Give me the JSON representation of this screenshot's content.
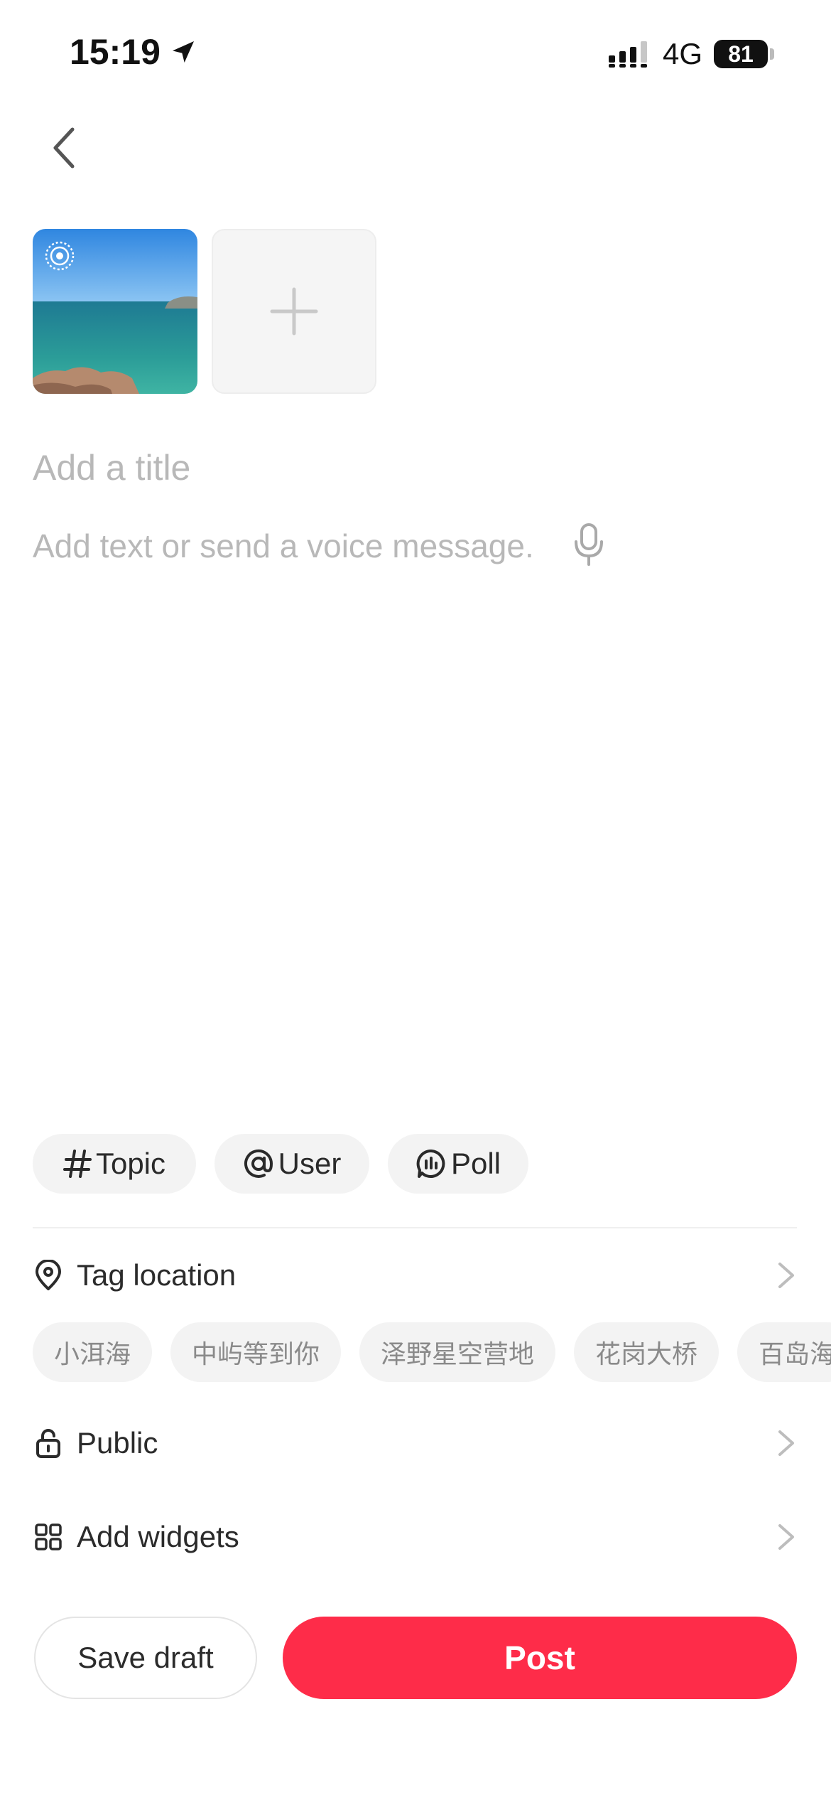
{
  "status_bar": {
    "time": "15:19",
    "network": "4G",
    "battery": "81",
    "icons": [
      "location-arrow-icon",
      "signal-icon",
      "battery-icon"
    ]
  },
  "nav": {
    "back_icon": "chevron-left-icon"
  },
  "media": {
    "live_icon": "live-photo-icon",
    "add_icon": "plus-icon"
  },
  "editor": {
    "title_placeholder": "Add a title",
    "body_placeholder": "Add text or send a voice message.",
    "mic_icon": "microphone-icon"
  },
  "chips": [
    {
      "label": "Topic",
      "icon": "hashtag-icon"
    },
    {
      "label": "User",
      "icon": "at-icon"
    },
    {
      "label": "Poll",
      "icon": "poll-icon"
    }
  ],
  "location": {
    "label": "Tag location",
    "icon": "location-pin-icon",
    "suggestions": [
      "小洱海",
      "中屿等到你",
      "泽野星空营地",
      "花岗大桥",
      "百岛海"
    ]
  },
  "visibility": {
    "label": "Public",
    "icon": "lock-open-icon"
  },
  "widgets": {
    "label": "Add widgets",
    "icon": "grid-icon"
  },
  "actions": {
    "save_draft": "Save draft",
    "post": "Post"
  },
  "colors": {
    "accent": "#fe2c49",
    "placeholder": "#b8b8b8",
    "chip_bg": "#f3f3f3"
  }
}
